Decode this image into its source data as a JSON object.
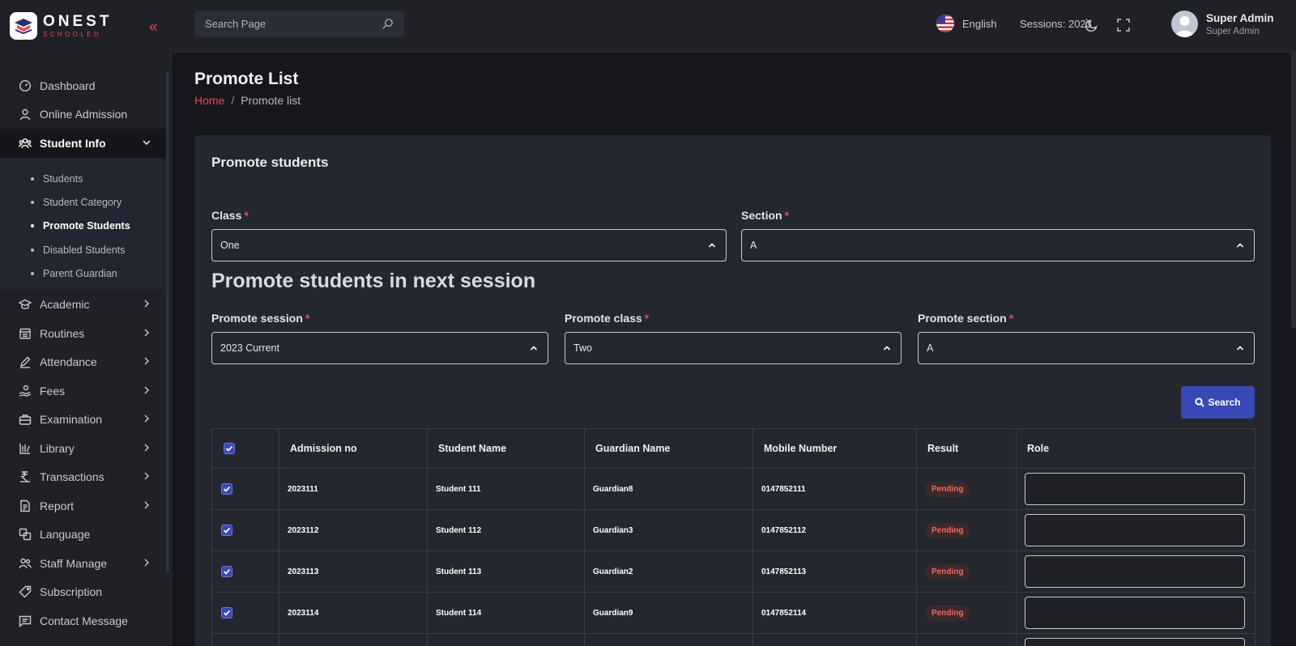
{
  "brand": {
    "name": "ONEST",
    "tagline": "SCHOOLED"
  },
  "sidebar": {
    "items": [
      {
        "label": "Dashboard",
        "icon": "dashboard-icon"
      },
      {
        "label": "Online Admission",
        "icon": "user-icon"
      },
      {
        "label": "Student Info",
        "icon": "users-group-icon",
        "expanded": true
      },
      {
        "label": "Academic",
        "icon": "graduation-cap-icon"
      },
      {
        "label": "Routines",
        "icon": "calendar-icon"
      },
      {
        "label": "Attendance",
        "icon": "pen-icon"
      },
      {
        "label": "Fees",
        "icon": "money-hand-icon"
      },
      {
        "label": "Examination",
        "icon": "briefcase-icon"
      },
      {
        "label": "Library",
        "icon": "library-icon"
      },
      {
        "label": "Transactions",
        "icon": "transactions-icon"
      },
      {
        "label": "Report",
        "icon": "report-icon"
      },
      {
        "label": "Language",
        "icon": "language-icon"
      },
      {
        "label": "Staff Manage",
        "icon": "staff-icon"
      },
      {
        "label": "Subscription",
        "icon": "tag-icon"
      },
      {
        "label": "Contact Message",
        "icon": "message-icon"
      }
    ],
    "student_info_sub": [
      "Students",
      "Student Category",
      "Promote Students",
      "Disabled Students",
      "Parent Guardian"
    ]
  },
  "topbar": {
    "search_placeholder": "Search Page",
    "language": "English",
    "session": "Sessions: 2023",
    "user_name": "Super Admin",
    "user_role": "Super Admin"
  },
  "page": {
    "title": "Promote List",
    "breadcrumb_home": "Home",
    "breadcrumb_current": "Promote list"
  },
  "form": {
    "card_title": "Promote students",
    "class_label": "Class",
    "class_value": "One",
    "section_label": "Section",
    "section_value": "A",
    "next_session_heading": "Promote students in next session",
    "promote_session_label": "Promote session",
    "promote_session_value": "2023 Current",
    "promote_class_label": "Promote class",
    "promote_class_value": "Two",
    "promote_section_label": "Promote section",
    "promote_section_value": "A",
    "search_button": "Search",
    "required_mark": "*"
  },
  "table": {
    "headers": [
      "Admission no",
      "Student Name",
      "Guardian Name",
      "Mobile Number",
      "Result",
      "Role"
    ],
    "rows": [
      {
        "admission": "2023111",
        "student": "Student 111",
        "guardian": "Guardian8",
        "mobile": "0147852111",
        "result": "Pending"
      },
      {
        "admission": "2023112",
        "student": "Student 112",
        "guardian": "Guardian3",
        "mobile": "0147852112",
        "result": "Pending"
      },
      {
        "admission": "2023113",
        "student": "Student 113",
        "guardian": "Guardian2",
        "mobile": "0147852113",
        "result": "Pending"
      },
      {
        "admission": "2023114",
        "student": "Student 114",
        "guardian": "Guardian9",
        "mobile": "0147852114",
        "result": "Pending"
      }
    ]
  },
  "colors": {
    "accent": "#e8475a",
    "primary": "#3848b7",
    "pending": "#ef6a5a"
  }
}
